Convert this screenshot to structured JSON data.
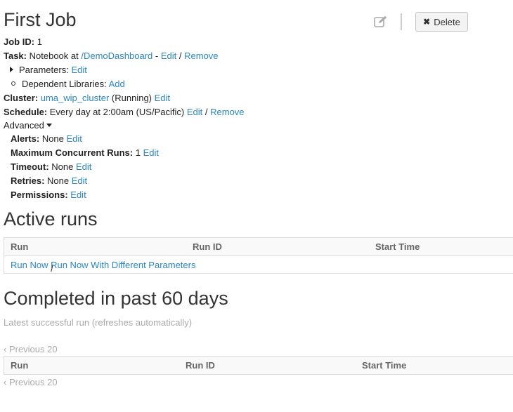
{
  "header": {
    "title": "First Job",
    "delete_label": "Delete"
  },
  "details": {
    "job_id_label": "Job ID:",
    "job_id": "1",
    "task_label": "Task:",
    "task_text": "Notebook at",
    "task_link": "/DemoDashboard",
    "task_sep": "-",
    "task_edit": "Edit",
    "task_slash": "/",
    "task_remove": "Remove",
    "parameters_label": "Parameters:",
    "parameters_edit": "Edit",
    "dep_libs_label": "Dependent Libraries:",
    "dep_libs_add": "Add",
    "cluster_label": "Cluster:",
    "cluster_link": "uma_wip_cluster",
    "cluster_status": "(Running)",
    "cluster_edit": "Edit",
    "schedule_label": "Schedule:",
    "schedule_text": "Every day at 2:00am (US/Pacific)",
    "schedule_edit": "Edit",
    "schedule_slash": "/",
    "schedule_remove": "Remove",
    "advanced_label": "Advanced",
    "alerts_label": "Alerts:",
    "alerts_value": "None",
    "alerts_edit": "Edit",
    "max_runs_label": "Maximum Concurrent Runs:",
    "max_runs_value": "1",
    "max_runs_edit": "Edit",
    "timeout_label": "Timeout:",
    "timeout_value": "None",
    "timeout_edit": "Edit",
    "retries_label": "Retries:",
    "retries_value": "None",
    "retries_edit": "Edit",
    "permissions_label": "Permissions:",
    "permissions_edit": "Edit"
  },
  "active_runs": {
    "heading": "Active runs",
    "columns": [
      "Run",
      "Run ID",
      "Start Time"
    ],
    "run_now": "Run Now",
    "slash": "/",
    "run_now_params": "Run Now With Different Parameters"
  },
  "completed": {
    "heading": "Completed in past 60 days",
    "subtitle": "Latest successful run (refreshes automatically)",
    "previous": "‹ Previous 20",
    "columns": [
      "Run",
      "Run ID",
      "Start Time"
    ]
  },
  "icons": {
    "edit": "pencil-square-icon",
    "delete": "x-icon"
  },
  "colors": {
    "link": "#2a86c1",
    "muted": "#999999"
  }
}
